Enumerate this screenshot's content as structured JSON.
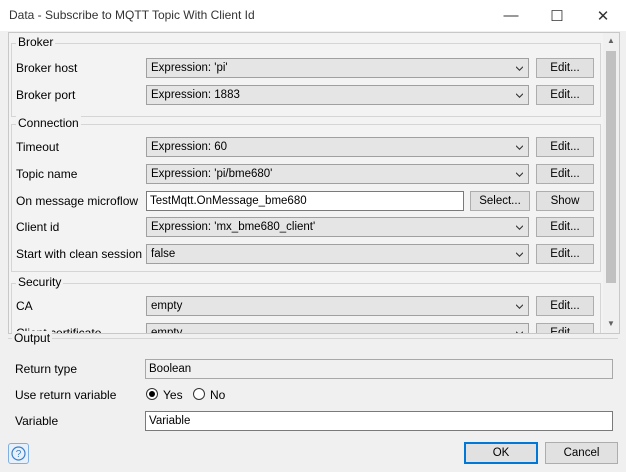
{
  "window": {
    "title": "Data - Subscribe to MQTT Topic With Client Id",
    "minimize_glyph": "—",
    "maximize_glyph": "☐",
    "close_glyph": "✕"
  },
  "broker": {
    "legend": "Broker",
    "host_label": "Broker host",
    "host_value": "Expression: 'pi'",
    "port_label": "Broker port",
    "port_value": "Expression: 1883"
  },
  "connection": {
    "legend": "Connection",
    "timeout_label": "Timeout",
    "timeout_value": "Expression: 60",
    "topic_label": "Topic name",
    "topic_value": "Expression: 'pi/bme680'",
    "microflow_label": "On message microflow",
    "microflow_value": "TestMqtt.OnMessage_bme680",
    "client_label": "Client id",
    "client_value": "Expression: 'mx_bme680_client'",
    "clean_label": "Start with clean session",
    "clean_value": "false"
  },
  "security": {
    "legend": "Security",
    "ca_label": "CA",
    "ca_value": "empty",
    "cert_label": "Client certificate",
    "cert_value": "empty"
  },
  "buttons": {
    "edit": "Edit...",
    "select": "Select...",
    "show": "Show",
    "ok": "OK",
    "cancel": "Cancel",
    "help": "?"
  },
  "output": {
    "legend": "Output",
    "return_type_label": "Return type",
    "return_type_value": "Boolean",
    "use_return_label": "Use return variable",
    "yes": "Yes",
    "no": "No",
    "yes_selected": true,
    "variable_label": "Variable",
    "variable_value": "Variable"
  }
}
